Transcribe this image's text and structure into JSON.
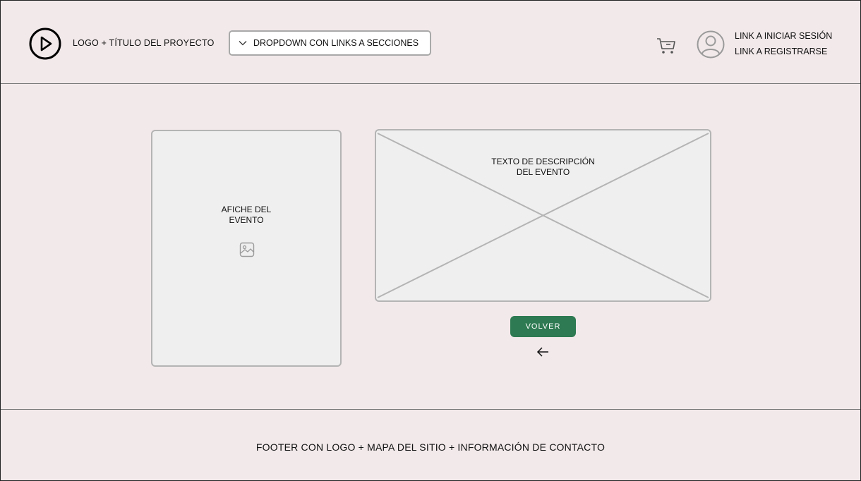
{
  "header": {
    "logo_title": "LOGO + TÍTULO DEL PROYECTO",
    "dropdown_label": "DROPDOWN CON LINKS A SECCIONES",
    "login_link": "LINK A INICIAR SESIÓN",
    "register_link": "LINK A REGISTRARSE",
    "icons": {
      "logo": "play-circle-icon",
      "dropdown": "chevron-down-icon",
      "cart": "cart-icon",
      "user": "user-avatar-icon"
    }
  },
  "main": {
    "poster_label_line1": "AFICHE DEL",
    "poster_label_line2": "EVENTO",
    "description_line1": "TEXTO DE DESCRIPCIÓN",
    "description_line2": "DEL EVENTO",
    "back_button": "VOLVER",
    "icons": {
      "poster": "image-icon",
      "back": "arrow-left-icon"
    }
  },
  "footer": {
    "text": "FOOTER CON LOGO + MAPA DEL SITIO + INFORMACIÓN DE CONTACTO"
  },
  "colors": {
    "background": "#f2e9ea",
    "accent_button": "#2e7a52",
    "placeholder_fill": "#efefef",
    "border": "#b4b4b4"
  }
}
